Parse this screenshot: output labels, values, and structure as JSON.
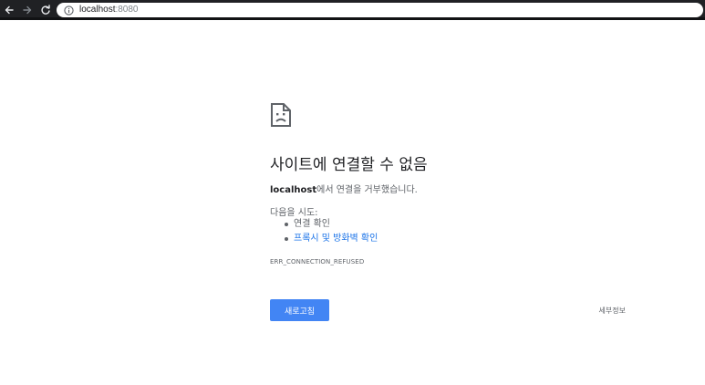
{
  "browser": {
    "url_host": "localhost",
    "url_port": ":8080",
    "icons": {
      "back": "back-arrow-icon",
      "forward": "forward-arrow-icon",
      "reload": "reload-icon",
      "site_info": "info-icon"
    }
  },
  "error_page": {
    "icon": "sad-page-icon",
    "heading": "사이트에 연결할 수 없음",
    "message_host": "localhost",
    "message_rest": "에서 연결을 거부했습니다.",
    "try_heading": "다음을 시도:",
    "suggestions": [
      {
        "text": "연결 확인",
        "is_link": false
      },
      {
        "text": "프록시 및 방화벽 확인",
        "is_link": true
      }
    ],
    "error_code": "ERR_CONNECTION_REFUSED",
    "reload_label": "새로고침",
    "details_label": "세부정보"
  },
  "colors": {
    "toolbar": "#202124",
    "primary_button": "#4285f4",
    "link": "#1a73e8",
    "heading": "#202124",
    "body_text": "#5f6368"
  }
}
